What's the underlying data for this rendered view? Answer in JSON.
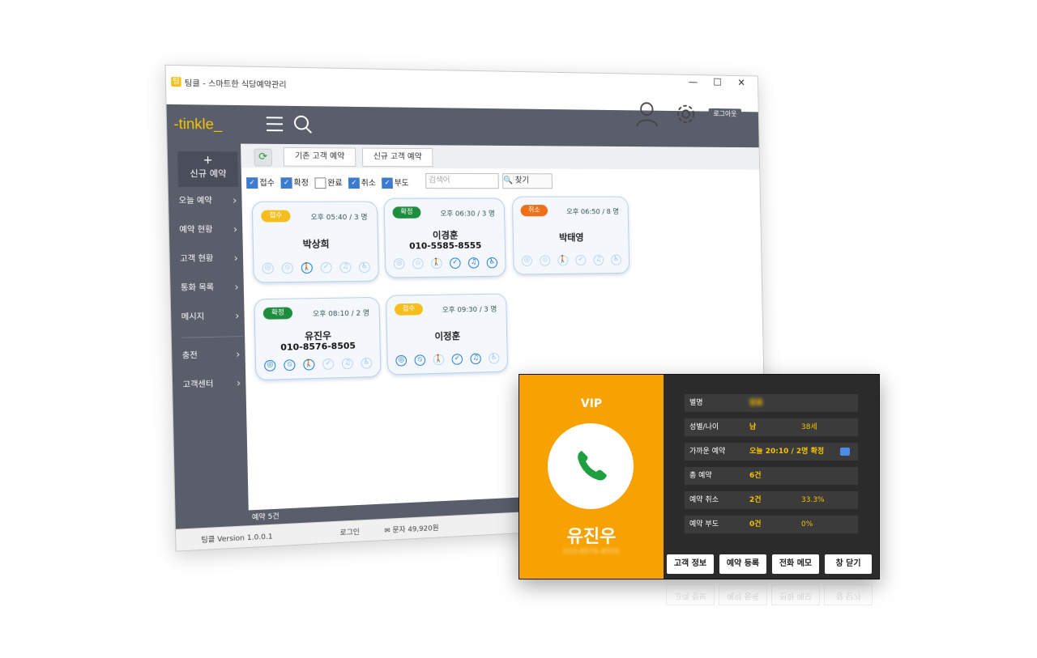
{
  "window": {
    "title": "팅클 - 스마트한 식당예약관리",
    "controls": [
      "—",
      "☐",
      "✕"
    ]
  },
  "brand": {
    "logo": "-tinkle_"
  },
  "header": {
    "logout_label": "로그아웃"
  },
  "sidebar": {
    "new_reservation": {
      "plus": "+",
      "label": "신규 예약"
    },
    "items": [
      {
        "label": "오늘 예약"
      },
      {
        "label": "예약 현황"
      },
      {
        "label": "고객 현황"
      },
      {
        "label": "통화 목록"
      },
      {
        "label": "메시지"
      },
      {
        "label": "충전"
      },
      {
        "label": "고객센터"
      }
    ],
    "chevron": "›"
  },
  "toolbar": {
    "tabs": [
      "기존 고객 예약",
      "신규 고객 예약"
    ]
  },
  "filters": {
    "checks": [
      {
        "label": "접수",
        "checked": true
      },
      {
        "label": "확정",
        "checked": true
      },
      {
        "label": "완료",
        "checked": false
      },
      {
        "label": "취소",
        "checked": true
      },
      {
        "label": "부도",
        "checked": true
      }
    ],
    "search_placeholder": "검색어",
    "find_label": "찾기"
  },
  "cards": [
    {
      "status": "접수",
      "status_color": "#f5be1d",
      "time": "오후 05:40",
      "people": "3 명",
      "name": "박상희",
      "phone": ""
    },
    {
      "status": "확정",
      "status_color": "#1e8e3e",
      "time": "오후 06:30",
      "people": "3 명",
      "name": "이경훈",
      "phone": "010-5585-8555"
    },
    {
      "status": "취소",
      "status_color": "#f0701a",
      "time": "오후 06:50",
      "people": "8 명",
      "name": "박태영",
      "phone": ""
    },
    {
      "status": "확정",
      "status_color": "#1e8e3e",
      "time": "오후 08:10",
      "people": "2 명",
      "name": "유진우",
      "phone": "010-8576-8505"
    },
    {
      "status": "접수",
      "status_color": "#f5be1d",
      "time": "오후 09:30",
      "people": "3 명",
      "name": "이정훈",
      "phone": ""
    }
  ],
  "status_strip": {
    "text": "예약 5건"
  },
  "bottom_bar": {
    "version": "팅클 Version 1.0.0.1",
    "login": "로그인",
    "sms": "문자 49,920원"
  },
  "popup": {
    "vip": "VIP",
    "name": "유진우",
    "phone": "010-8576-8505",
    "rows": [
      {
        "label": "별명",
        "value1": "없음",
        "value2": ""
      },
      {
        "label": "성별/나이",
        "value1": "남",
        "value2": "38세"
      },
      {
        "label": "가까운 예약",
        "value1": "오늘 20:10 / 2명 확정",
        "value2": ""
      },
      {
        "label": "총 예약",
        "value1": "6건",
        "value2": ""
      },
      {
        "label": "예약 취소",
        "value1": "2건",
        "value2": "33.3%"
      },
      {
        "label": "예약 부도",
        "value1": "0건",
        "value2": "0%"
      }
    ],
    "buttons": [
      "고객 정보",
      "예약 등록",
      "전화 메모",
      "창 닫기"
    ]
  },
  "colors": {
    "sidebar": "#5a5e6b",
    "logo": "#f5c400",
    "popup_accent": "#f7a200",
    "popup_value": "#f6c200"
  }
}
